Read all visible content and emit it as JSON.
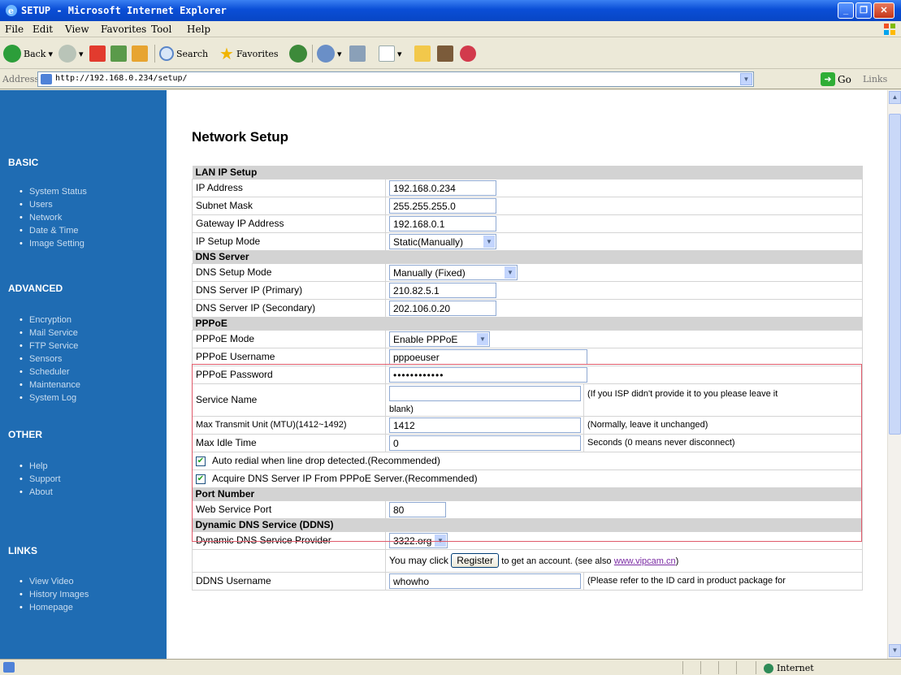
{
  "window": {
    "title": "SETUP - Microsoft Internet Explorer",
    "colors": {
      "titlebar": "#0a4ed6",
      "sidebar": "#1f6cb3",
      "section_header": "#d3d3d3",
      "highlight_border": "#e05a6a",
      "link": "#7a2aa3"
    }
  },
  "menu": [
    "File",
    "Edit",
    "View",
    "Favorites",
    "Tool",
    "Help"
  ],
  "toolbar": {
    "back_label": "Back",
    "search_label": "Search",
    "favorites_label": "Favorites"
  },
  "address": {
    "label": "Address",
    "url": "http://192.168.0.234/setup/",
    "go_label": "Go",
    "links_label": "Links"
  },
  "sidebar": {
    "sections": [
      {
        "heading": "BASIC",
        "items": [
          "System Status",
          "Users",
          "Network",
          "Date & Time",
          "Image Setting"
        ]
      },
      {
        "heading": "ADVANCED",
        "items": [
          "Encryption",
          "Mail Service",
          "FTP Service",
          "Sensors",
          "Scheduler",
          "Maintenance",
          "System Log"
        ]
      },
      {
        "heading": "OTHER",
        "items": [
          "Help",
          "Support",
          "About"
        ]
      },
      {
        "heading": "LINKS",
        "items": [
          "View Video",
          "History Images",
          "Homepage"
        ]
      }
    ]
  },
  "page": {
    "title": "Network Setup",
    "lan": {
      "header": "LAN IP Setup",
      "ip_label": "IP Address",
      "ip_value": "192.168.0.234",
      "subnet_label": "Subnet Mask",
      "subnet_value": "255.255.255.0",
      "gateway_label": "Gateway IP Address",
      "gateway_value": "192.168.0.1",
      "mode_label": "IP Setup Mode",
      "mode_value": "Static(Manually)"
    },
    "dns": {
      "header": "DNS Server",
      "mode_label": "DNS Setup Mode",
      "mode_value": "Manually (Fixed)",
      "primary_label": "DNS Server IP (Primary)",
      "primary_value": "210.82.5.1",
      "secondary_label": "DNS Server IP (Secondary)",
      "secondary_value": "202.106.0.20"
    },
    "pppoe": {
      "header": "PPPoE",
      "mode_label": "PPPoE Mode",
      "mode_value": "Enable PPPoE",
      "username_label": "PPPoE Username",
      "username_value": "pppoeuser",
      "password_label": "PPPoE Password",
      "password_value": "••••••••••••",
      "service_label": "Service Name",
      "service_value": "",
      "service_note_1": "(If you ISP didn't provide it to you please leave it",
      "service_note_2": "blank)",
      "mtu_label": "Max Transmit Unit (MTU)(1412~1492)",
      "mtu_value": "1412",
      "mtu_note": "(Normally, leave it unchanged)",
      "idle_label": "Max Idle Time",
      "idle_value": "0",
      "idle_note": "Seconds (0 means never disconnect)",
      "auto_redial_label": "Auto redial when line drop detected.(Recommended)",
      "auto_redial_checked": true,
      "acquire_dns_label": "Acquire DNS Server IP From PPPoE Server.(Recommended)",
      "acquire_dns_checked": true
    },
    "port": {
      "header": "Port Number",
      "web_label": "Web Service Port",
      "web_value": "80"
    },
    "ddns": {
      "header": "Dynamic DNS Service (DDNS)",
      "provider_label": "Dynamic DNS Service Provider",
      "provider_value": "3322.org",
      "register_prefix": "You may click",
      "register_button": "Register",
      "register_suffix": "to get an account. (see also",
      "register_link": "www.vipcam.cn",
      "register_close": ")",
      "username_label": "DDNS Username",
      "username_value": "whowho",
      "username_note": "(Please refer to the ID card in product package for"
    }
  },
  "status": {
    "zone": "Internet"
  }
}
